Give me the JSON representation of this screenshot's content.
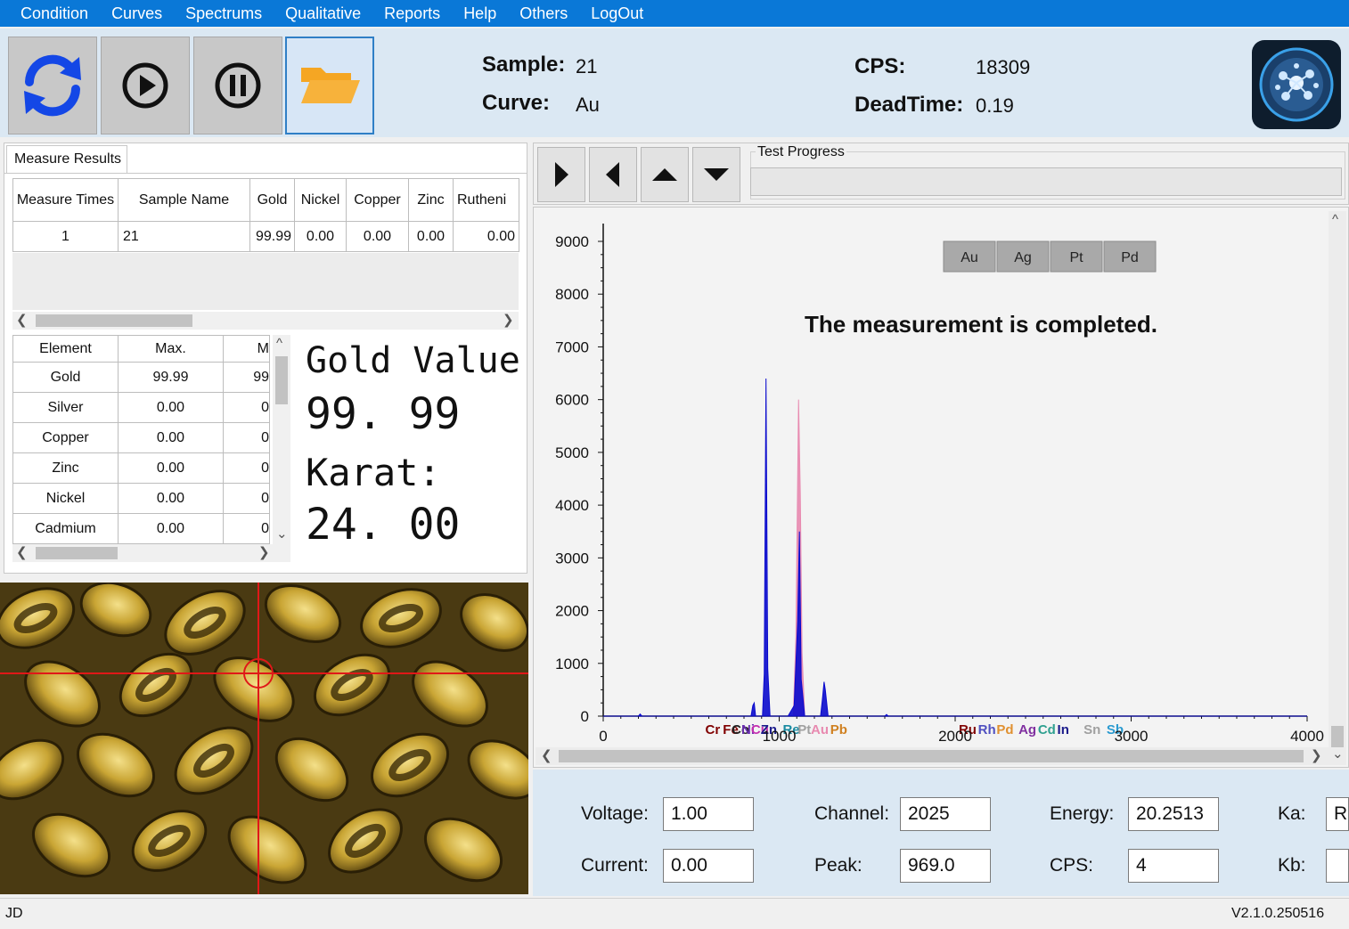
{
  "menu": [
    "Condition",
    "Curves",
    "Spectrums",
    "Qualitative",
    "Reports",
    "Help",
    "Others",
    "LogOut"
  ],
  "toolbar": {
    "sample_label": "Sample:",
    "sample_value": "21",
    "curve_label": "Curve:",
    "curve_value": "Au",
    "cps_label": "CPS:",
    "cps_value": "18309",
    "deadtime_label": "DeadTime:",
    "deadtime_value": "0.19"
  },
  "results": {
    "tab_label": "Measure Results",
    "columns": [
      "Measure Times",
      "Sample Name",
      "Gold",
      "Nickel",
      "Copper",
      "Zinc",
      "Rutheni"
    ],
    "rows": [
      [
        "1",
        "21",
        "99.99",
        "0.00",
        "0.00",
        "0.00",
        "0.00"
      ]
    ]
  },
  "elements": {
    "columns": [
      "Element",
      "Max.",
      "M"
    ],
    "rows": [
      [
        "Gold",
        "99.99",
        "99"
      ],
      [
        "Silver",
        "0.00",
        "0"
      ],
      [
        "Copper",
        "0.00",
        "0"
      ],
      [
        "Zinc",
        "0.00",
        "0"
      ],
      [
        "Nickel",
        "0.00",
        "0"
      ],
      [
        "Cadmium",
        "0.00",
        "0"
      ]
    ]
  },
  "summary": {
    "gold_label": "Gold Value",
    "gold_value": "99. 99",
    "karat_label": "Karat:",
    "karat_value": "24. 00"
  },
  "progress": {
    "label": "Test Progress",
    "value": 0
  },
  "chart_data": {
    "type": "area",
    "message": "The measurement is completed.",
    "element_buttons": [
      "Au",
      "Ag",
      "Pt",
      "Pd"
    ],
    "xlim": [
      0,
      4000
    ],
    "ylim": [
      0,
      9000
    ],
    "x_ticks": [
      "0",
      "1000",
      "2000",
      "3000",
      "4000"
    ],
    "y_ticks": [
      "9000",
      "8000",
      "7000",
      "6000",
      "5000",
      "4000",
      "3000",
      "2000",
      "1000",
      "0"
    ],
    "series": [
      {
        "color": "#0a0acd",
        "points": [
          [
            0,
            0
          ],
          [
            200,
            0
          ],
          [
            210,
            40
          ],
          [
            220,
            0
          ],
          [
            840,
            0
          ],
          [
            850,
            200
          ],
          [
            858,
            250
          ],
          [
            866,
            0
          ],
          [
            905,
            0
          ],
          [
            915,
            800
          ],
          [
            925,
            6400
          ],
          [
            935,
            900
          ],
          [
            948,
            0
          ],
          [
            1050,
            0
          ],
          [
            1085,
            200
          ],
          [
            1105,
            1800
          ],
          [
            1115,
            3500
          ],
          [
            1125,
            700
          ],
          [
            1145,
            0
          ],
          [
            1235,
            0
          ],
          [
            1245,
            300
          ],
          [
            1255,
            650
          ],
          [
            1262,
            500
          ],
          [
            1278,
            0
          ],
          [
            1600,
            0
          ],
          [
            1610,
            30
          ],
          [
            1620,
            0
          ],
          [
            4000,
            0
          ]
        ]
      },
      {
        "color": "#e88ab0",
        "points": [
          [
            0,
            0
          ],
          [
            1080,
            0
          ],
          [
            1095,
            1500
          ],
          [
            1110,
            6000
          ],
          [
            1120,
            4200
          ],
          [
            1130,
            1200
          ],
          [
            1145,
            0
          ],
          [
            4000,
            0
          ]
        ]
      }
    ],
    "element_markers": [
      {
        "label": "Cr",
        "x": 580,
        "color": "#800000"
      },
      {
        "label": "Fe",
        "x": 680,
        "color": "#800000"
      },
      {
        "label": "Co",
        "x": 730,
        "color": "#222222"
      },
      {
        "label": "Ni",
        "x": 785,
        "color": "#6a2fb0"
      },
      {
        "label": "Cu",
        "x": 840,
        "color": "#c42fb0"
      },
      {
        "label": "Zn",
        "x": 895,
        "color": "#1a1a8a"
      },
      {
        "label": "Re",
        "x": 1020,
        "color": "#1a8aa0"
      },
      {
        "label": "Pt",
        "x": 1105,
        "color": "#a0a0a0"
      },
      {
        "label": "Au",
        "x": 1180,
        "color": "#e88ab0"
      },
      {
        "label": "Pb",
        "x": 1290,
        "color": "#d08020"
      },
      {
        "label": "Ru",
        "x": 2020,
        "color": "#800000"
      },
      {
        "label": "Rh",
        "x": 2130,
        "color": "#5050c0"
      },
      {
        "label": "Pd",
        "x": 2235,
        "color": "#e09030"
      },
      {
        "label": "Ag",
        "x": 2360,
        "color": "#8030a0"
      },
      {
        "label": "Cd",
        "x": 2470,
        "color": "#30a090"
      },
      {
        "label": "In",
        "x": 2580,
        "color": "#1a1a8a"
      },
      {
        "label": "Sn",
        "x": 2730,
        "color": "#a0a0a0"
      },
      {
        "label": "Sb",
        "x": 2860,
        "color": "#2a9ad0"
      }
    ]
  },
  "params": {
    "voltage_label": "Voltage:",
    "voltage_value": "1.00",
    "current_label": "Current:",
    "current_value": "0.00",
    "channel_label": "Channel:",
    "channel_value": "2025",
    "peak_label": "Peak:",
    "peak_value": "969.0",
    "energy_label": "Energy:",
    "energy_value": "20.2513",
    "cps_label": "CPS:",
    "cps_value": "4",
    "ka_label": "Ka:",
    "ka_value": "R",
    "kb_label": "Kb:",
    "kb_value": ""
  },
  "status": {
    "left": "JD",
    "version": "V2.1.0.250516"
  },
  "icons": {
    "refresh": "refresh-icon",
    "play": "play-icon",
    "pause": "pause-icon",
    "folder": "folder-open-icon",
    "logo": "molecule-logo-icon"
  }
}
